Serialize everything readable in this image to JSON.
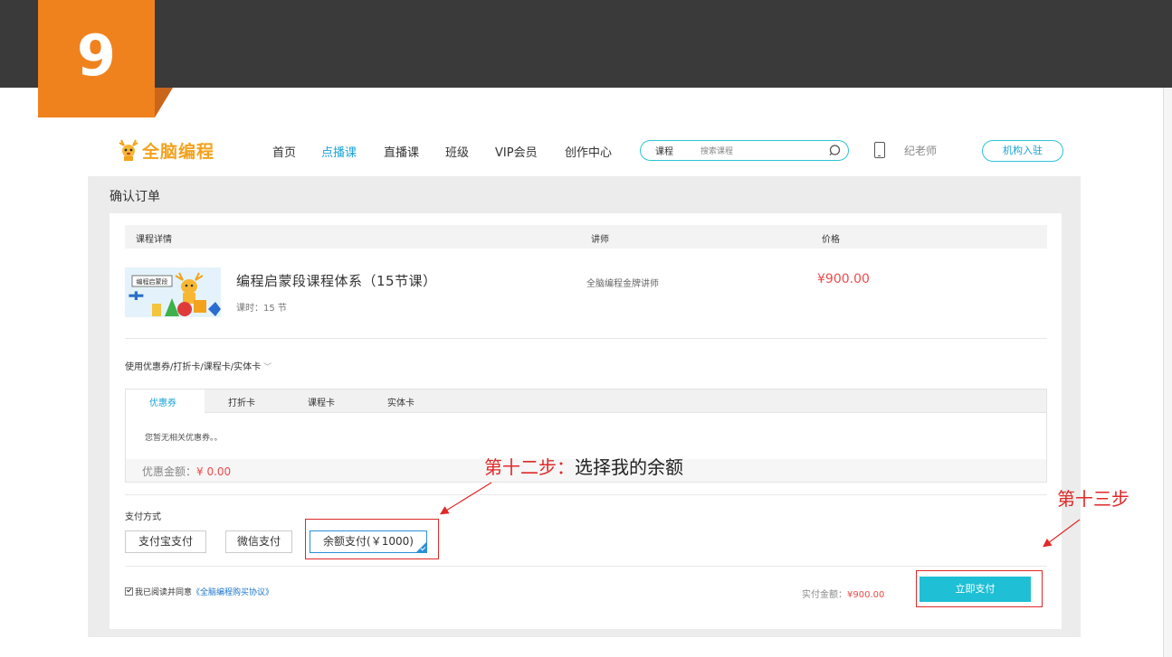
{
  "step_badge": "9",
  "nav": {
    "logo_text": "全脑编程",
    "items": [
      {
        "label": "首页",
        "active": false
      },
      {
        "label": "点播课",
        "active": true
      },
      {
        "label": "直播课",
        "active": false
      },
      {
        "label": "班级",
        "active": false
      },
      {
        "label": "VIP会员",
        "active": false
      },
      {
        "label": "创作中心",
        "active": false
      }
    ],
    "search_category": "课程",
    "search_placeholder": "搜索课程",
    "user_name": "纪老师",
    "join_button": "机构入驻"
  },
  "order": {
    "page_title": "确认订单",
    "table_headers": {
      "detail": "课程详情",
      "teacher": "讲师",
      "price": "价格"
    },
    "course": {
      "name": "编程启蒙段课程体系（15节课）",
      "hours": "课时：15 节",
      "teacher": "全脑编程金牌讲师",
      "price": "¥900.00",
      "thumb_caption": "编程启蒙段"
    },
    "coupon": {
      "line": "使用优惠券/打折卡/课程卡/实体卡",
      "tabs": [
        "优惠券",
        "打折卡",
        "课程卡",
        "实体卡"
      ],
      "active_tab": "优惠券",
      "empty_text": "您暂无相关优惠券。。",
      "discount_label": "优惠金额：",
      "discount_value": "¥ 0.00"
    },
    "payment": {
      "title": "支付方式",
      "methods": [
        {
          "label": "支付宝支付",
          "selected": false
        },
        {
          "label": "微信支付",
          "selected": false
        },
        {
          "label": "余额支付(￥1000)",
          "selected": true
        }
      ]
    },
    "agreement": {
      "prefix": "我已阅读并同意",
      "link": "《全脑编程购买协议》",
      "checked": true
    },
    "total_label": "实付金额：",
    "total_value": "¥900.00",
    "pay_button": "立即支付"
  },
  "annotations": {
    "step12_prefix": "第十二步：",
    "step12_action": "选择我的余额",
    "step13": "第十三步",
    "color": "#e02828"
  }
}
